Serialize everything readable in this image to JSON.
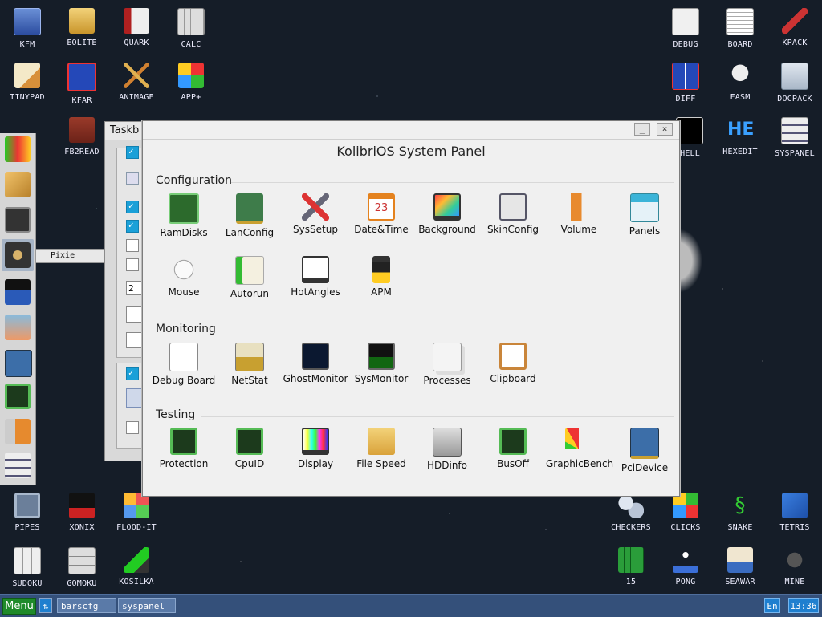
{
  "desktop_icons": {
    "kfm": "KFM",
    "eolite": "EOLITE",
    "quark": "QUARK",
    "calc": "CALC",
    "tinypad": "TINYPAD",
    "kfar": "KFAR",
    "animage": "ANIMAGE",
    "appplus": "APP+",
    "fb2read": "FB2READ",
    "debug": "DEBUG",
    "board": "BOARD",
    "kpack": "KPACK",
    "diff": "DIFF",
    "fasm": "FASM",
    "docpack": "DOCPACK",
    "shell_partial": "HELL",
    "hexedit": "HEXEDIT",
    "syspanel": "SYSPANEL",
    "pipes": "PIPES",
    "xonix": "XONIX",
    "floodit": "FLOOD-IT",
    "checkers": "CHECKERS",
    "clicks": "CLICKS",
    "snake": "SNAKE",
    "tetris": "TETRIS",
    "sudoku": "SUDOKU",
    "gomoku": "GOMOKU",
    "kosilka": "KOSILKA",
    "fifteen": "15",
    "pong": "PONG",
    "seawar": "SEAWAR",
    "mine": "MINE"
  },
  "back_window": {
    "title": "Taskb",
    "partial_value": "2"
  },
  "dock": {
    "tooltip": "Pixie"
  },
  "panel": {
    "title": "KolibriOS System Panel",
    "minimize": "_",
    "close": "×",
    "sections": {
      "configuration": "Configuration",
      "monitoring": "Monitoring",
      "testing": "Testing"
    },
    "config_apps": [
      "RamDisks",
      "LanConfig",
      "SysSetup",
      "Date&Time",
      "Background",
      "SkinConfig",
      "Volume",
      "Panels",
      "Mouse",
      "Autorun",
      "HotAngles",
      "APM"
    ],
    "monitor_apps": [
      "Debug Board",
      "NetStat",
      "GhostMonitor",
      "SysMonitor",
      "Processes",
      "Clipboard"
    ],
    "testing_apps": [
      "Protection",
      "CpuID",
      "Display",
      "File Speed",
      "HDDinfo",
      "BusOff",
      "GraphicBench",
      "PciDevice"
    ],
    "date_day": "23"
  },
  "taskbar": {
    "menu": "Menu",
    "arrow": "⇅",
    "tasks": [
      "barscfg",
      "syspanel"
    ],
    "lang": "En",
    "time": "13:36"
  },
  "colors": {
    "desktop": "#151d28",
    "taskbar": "#34507a",
    "menu": "#1f8a2a",
    "clock": "#1f7fcf"
  }
}
